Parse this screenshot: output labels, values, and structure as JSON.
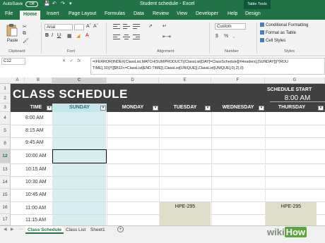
{
  "title_bar": {
    "autosave_label": "AutoSave",
    "autosave_state": "Off",
    "document_title": "Student schedule  -  Excel",
    "context_tab": "Table Tools"
  },
  "ribbon_tabs": [
    "File",
    "Home",
    "Insert",
    "Page Layout",
    "Formulas",
    "Data",
    "Review",
    "View",
    "Developer",
    "Help",
    "Design"
  ],
  "active_ribbon_tab": "Home",
  "ribbon": {
    "paste_label": "Paste",
    "clipboard_label": "Clipboard",
    "font_name": "Arial",
    "font_size": "",
    "font_label": "Font",
    "alignment_label": "Alignment",
    "number_format": "Custom",
    "number_label": "Number",
    "conditional_formatting": "Conditional Formatting",
    "format_as_table": "Format as Table",
    "cell_styles": "Cell Styles",
    "styles_label": "Styles",
    "accent_color": "#217346"
  },
  "formula_bar": {
    "name_box": "C12",
    "formula_line1": "=IFERROR(INDEX(ClassList,MATCH(SUMPRODUCT((ClassList[DAY]=ClassSchedule[[#Headers],[SUNDAY]])*(ROU",
    "formula_line2": "TIME],10))*([$B12<=ClassList[END TIME]),ClassList[UNIQUE]),ClassList[UNIQUE],0),2),0)"
  },
  "columns": [
    "A",
    "B",
    "C",
    "D",
    "E",
    "F",
    "G"
  ],
  "rows": [
    "1",
    "2",
    "3",
    "4",
    "5",
    "6",
    "7",
    "8",
    "9",
    "10",
    "11",
    "12",
    "13",
    "14",
    "15",
    "16",
    "17"
  ],
  "schedule": {
    "title": "CLASS SCHEDULE",
    "start_label": "SCHEDULE START",
    "start_value": "8:00 AM",
    "headers": [
      "TIME",
      "SUNDAY",
      "MONDAY",
      "TUESDAY",
      "WEDNESDAY",
      "THURSDAY"
    ],
    "times": [
      "8:00 AM",
      "8:15 AM",
      "9:45 AM",
      "10:00 AM",
      "10:15 AM",
      "10:30 AM",
      "10:45 AM",
      "11:00 AM",
      "11:15 AM"
    ],
    "events": [
      {
        "day": "TUESDAY",
        "label": "HPE-295"
      },
      {
        "day": "THURSDAY",
        "label": "HPE-295"
      }
    ],
    "band_color": "#404040",
    "sunday_color": "#c4e6eb",
    "event_color": "#deddc8"
  },
  "sheet_tabs": [
    "Class Schedule",
    "Class List",
    "Sheet1"
  ],
  "active_sheet": "Class Schedule",
  "watermark": {
    "wiki": "wiki",
    "how": "How"
  }
}
